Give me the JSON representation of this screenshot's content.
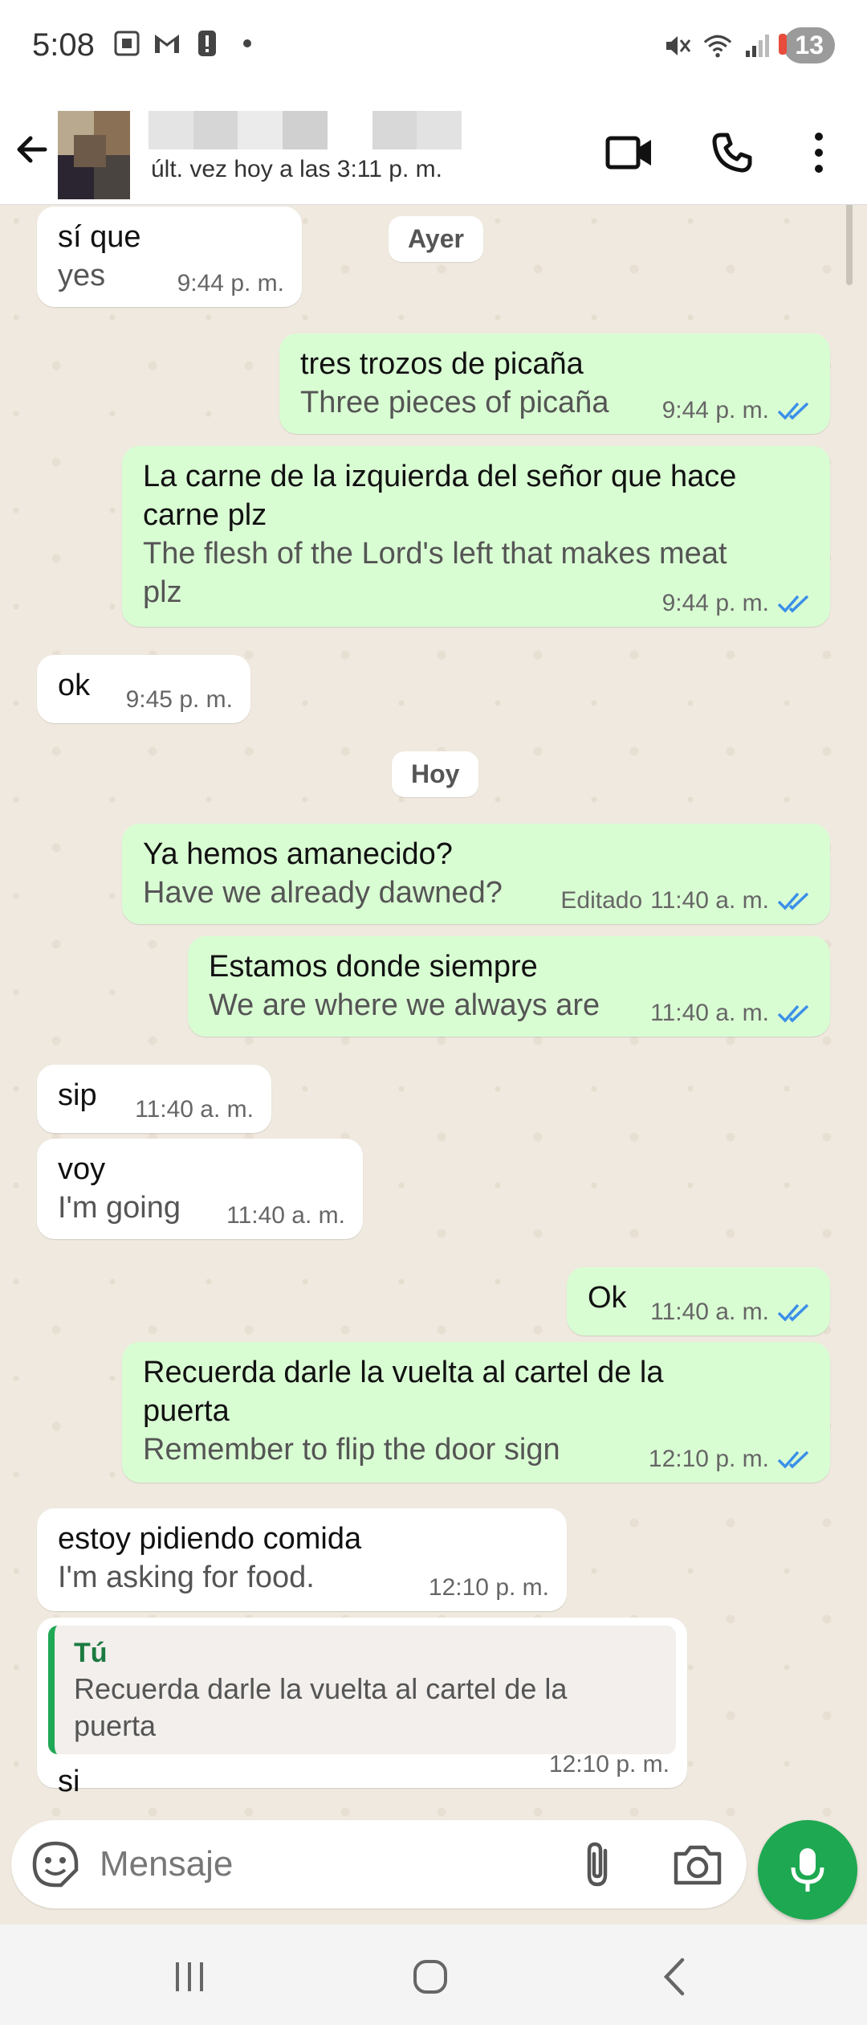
{
  "status_bar": {
    "time": "5:08",
    "battery_badge": "13",
    "icons": [
      "screenshot-icon",
      "gmail-icon",
      "alert-icon",
      "dot-icon",
      "mute-icon",
      "wifi-icon",
      "signal-icon"
    ]
  },
  "header": {
    "last_seen": "últ. vez hoy a las 3:11 p. m."
  },
  "day_chips": {
    "yesterday": "Ayer",
    "today": "Hoy"
  },
  "messages": [
    {
      "dir": "in",
      "text": "sí que",
      "translation": "yes",
      "time": "9:44 p. m."
    },
    {
      "dir": "out",
      "text": "tres trozos de picaña",
      "translation": "Three pieces of picaña",
      "time": "9:44 p. m."
    },
    {
      "dir": "out",
      "text_lines": [
        "La carne de la izquierda del señor que hace",
        "carne plz"
      ],
      "translation_lines": [
        "The flesh of the Lord's left that makes meat",
        "plz"
      ],
      "time": "9:44 p. m."
    },
    {
      "dir": "in",
      "text": "ok",
      "time": "9:45 p. m."
    },
    {
      "dir": "out",
      "text": "Ya hemos amanecido?",
      "translation": "Have we already dawned?",
      "edited": "Editado",
      "time": "11:40 a. m."
    },
    {
      "dir": "out",
      "text": "Estamos donde siempre",
      "translation": "We are where we always are",
      "time": "11:40 a. m."
    },
    {
      "dir": "in",
      "text": "sip",
      "time": "11:40 a. m."
    },
    {
      "dir": "in",
      "text": "voy",
      "translation": "I'm going",
      "time": "11:40 a. m."
    },
    {
      "dir": "out",
      "text": "Ok",
      "time": "11:40 a. m."
    },
    {
      "dir": "out",
      "text_lines": [
        "Recuerda darle la vuelta al cartel de la",
        "puerta"
      ],
      "translation": "Remember to flip the door sign",
      "time": "12:10 p. m."
    },
    {
      "dir": "in",
      "text": "estoy pidiendo comida",
      "translation": "I'm asking for food.",
      "time": "12:10 p. m."
    },
    {
      "dir": "in",
      "quote_author": "Tú",
      "quote_text": "Recuerda darle la vuelta al cartel de la puerta",
      "text": "si",
      "time": "12:10 p. m."
    }
  ],
  "input": {
    "placeholder": "Mensaje"
  },
  "colors": {
    "outgoing_bubble": "#d9fdd3",
    "incoming_bubble": "#ffffff",
    "chat_background": "#efe9df",
    "accent_green": "#1da851",
    "read_ticks": "#3b8fe8"
  }
}
